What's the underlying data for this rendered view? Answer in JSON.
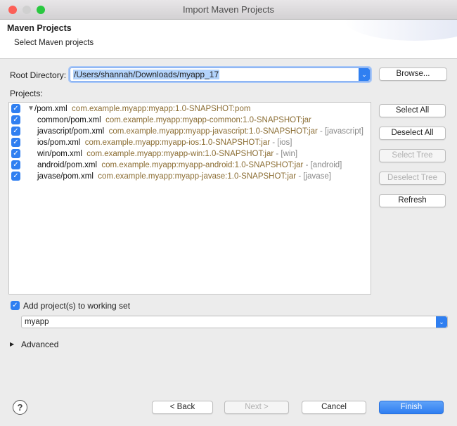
{
  "window": {
    "title": "Import Maven Projects"
  },
  "header": {
    "title": "Maven Projects",
    "subtitle": "Select Maven projects"
  },
  "root": {
    "label": "Root Directory:",
    "value": "/Users/shannah/Downloads/myapp_17",
    "browse": "Browse..."
  },
  "projects": {
    "label": "Projects:",
    "items": [
      {
        "name": "/pom.xml",
        "coords": "com.example.myapp:myapp:1.0-SNAPSHOT:pom",
        "suffix": "",
        "checked": true
      },
      {
        "name": "common/pom.xml",
        "coords": "com.example.myapp:myapp-common:1.0-SNAPSHOT:jar",
        "suffix": "",
        "checked": true
      },
      {
        "name": "javascript/pom.xml",
        "coords": "com.example.myapp:myapp-javascript:1.0-SNAPSHOT:jar",
        "suffix": " - [javascript]",
        "checked": true
      },
      {
        "name": "ios/pom.xml",
        "coords": "com.example.myapp:myapp-ios:1.0-SNAPSHOT:jar",
        "suffix": " - [ios]",
        "checked": true
      },
      {
        "name": "win/pom.xml",
        "coords": "com.example.myapp:myapp-win:1.0-SNAPSHOT:jar",
        "suffix": " - [win]",
        "checked": true
      },
      {
        "name": "android/pom.xml",
        "coords": "com.example.myapp:myapp-android:1.0-SNAPSHOT:jar",
        "suffix": " - [android]",
        "checked": true
      },
      {
        "name": "javase/pom.xml",
        "coords": "com.example.myapp:myapp-javase:1.0-SNAPSHOT:jar",
        "suffix": " - [javase]",
        "checked": true
      }
    ]
  },
  "side_buttons": {
    "select_all": "Select All",
    "deselect_all": "Deselect All",
    "select_tree": "Select Tree",
    "deselect_tree": "Deselect Tree",
    "refresh": "Refresh"
  },
  "working_set": {
    "label": "Add project(s) to working set",
    "checked": true,
    "value": "myapp"
  },
  "advanced": {
    "label": "Advanced"
  },
  "footer": {
    "help": "?",
    "back": "< Back",
    "next": "Next >",
    "cancel": "Cancel",
    "finish": "Finish"
  }
}
